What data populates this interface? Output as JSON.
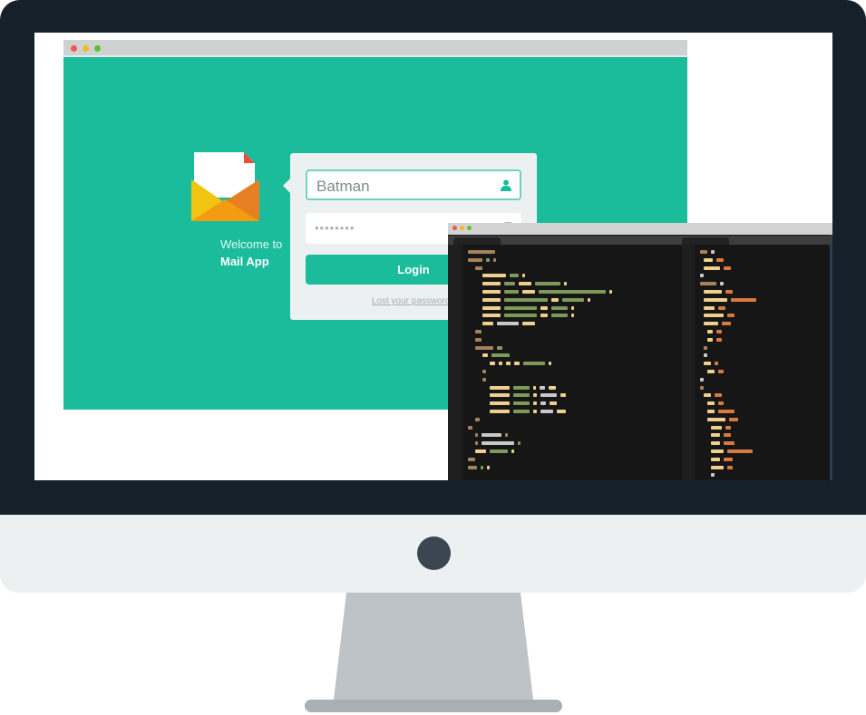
{
  "login_app": {
    "welcome_text": "Welcome to",
    "app_name": "Mail App",
    "username_value": "Batman",
    "password_value": "••••••••",
    "login_button": "Login",
    "lost_password_link": "Lost your password?"
  },
  "icons": {
    "logo": "envelope-icon",
    "username": "user-icon",
    "password": "lock-icon"
  },
  "colors": {
    "accent": "#1abc9c",
    "bezel": "#15202b",
    "card": "#ecf0f1",
    "editor_bg": "#161616"
  }
}
